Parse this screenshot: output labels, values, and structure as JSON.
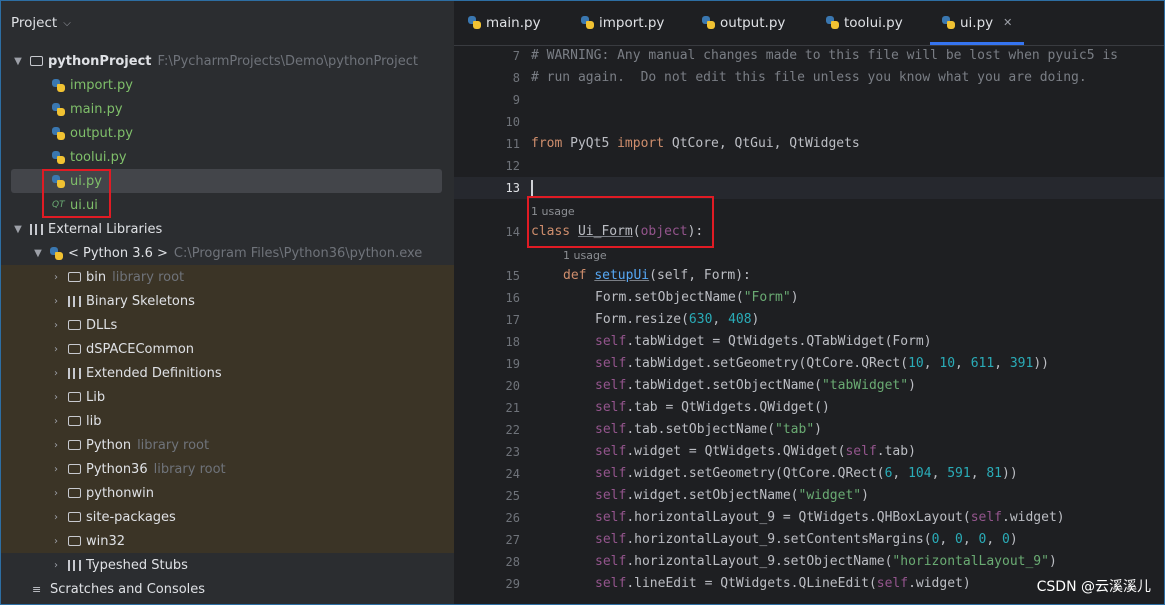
{
  "project_header": "Project",
  "tree": {
    "root_name": "pythonProject",
    "root_path": "F:\\PycharmProjects\\Demo\\pythonProject",
    "files": [
      "import.py",
      "main.py",
      "output.py",
      "toolui.py",
      "ui.py",
      "ui.ui"
    ],
    "external_libraries": "External Libraries",
    "sdk": "< Python 3.6 >",
    "sdk_path": "C:\\Program Files\\Python36\\python.exe",
    "library_root_hint": "library root",
    "folders": [
      "bin",
      "Binary Skeletons",
      "DLLs",
      "dSPACECommon",
      "Extended Definitions",
      "Lib",
      "lib",
      "Python",
      "Python36",
      "pythonwin",
      "site-packages",
      "win32",
      "Typeshed Stubs"
    ],
    "scratches": "Scratches and Consoles"
  },
  "tabs": [
    "main.py",
    "import.py",
    "output.py",
    "toolui.py",
    "ui.py"
  ],
  "active_tab": "ui.py",
  "usage_hint": "1 usage",
  "gutter": [
    "7",
    "8",
    "9",
    "10",
    "11",
    "12",
    "13",
    "14",
    "15",
    "16",
    "17",
    "18",
    "19",
    "20",
    "21",
    "22",
    "23",
    "24",
    "25",
    "26",
    "27",
    "28",
    "29"
  ],
  "code": {
    "l7": "# WARNING: Any manual changes made to this file will be lost when pyuic5 is",
    "l8": "# run again.  Do not edit this file unless you know what you are doing.",
    "l11_from": "from",
    "l11_mod": " PyQt5 ",
    "l11_import": "import",
    "l11_rest": " QtCore, QtGui, QtWidgets",
    "l14_class": "class",
    "l14_name": "Ui_Form",
    "l14_base": "object",
    "l15_def": "def",
    "l15_fn": "setupUi",
    "l15_args": "self, Form",
    "l16": "Form.setObjectName(",
    "l16_s": "\"Form\"",
    "l17": "Form.resize(",
    "l17_a": "630",
    "l17_b": "408",
    "l18": ".tabWidget = QtWidgets.QTabWidget(Form)",
    "l19": ".tabWidget.setGeometry(QtCore.QRect(",
    "l19_n": [
      "10",
      "10",
      "611",
      "391"
    ],
    "l20": ".tabWidget.setObjectName(",
    "l20_s": "\"tabWidget\"",
    "l21": ".tab = QtWidgets.QWidget()",
    "l22": ".tab.setObjectName(",
    "l22_s": "\"tab\"",
    "l23": ".widget = QtWidgets.QWidget(",
    "l23_b": ".tab)",
    "l24": ".widget.setGeometry(QtCore.QRect(",
    "l24_n": [
      "6",
      "104",
      "591",
      "81"
    ],
    "l25": ".widget.setObjectName(",
    "l25_s": "\"widget\"",
    "l26": ".horizontalLayout_9 = QtWidgets.QHBoxLayout(",
    "l26_b": ".widget)",
    "l27": ".horizontalLayout_9.setContentsMargins(",
    "l27_n": [
      "0",
      "0",
      "0",
      "0"
    ],
    "l28": ".horizontalLayout_9.setObjectName(",
    "l28_s": "\"horizontalLayout_9\"",
    "l29": ".lineEdit = QtWidgets.QLineEdit(",
    "l29_b": ".widget)",
    "self": "self"
  },
  "watermark": "CSDN @云溪溪儿"
}
